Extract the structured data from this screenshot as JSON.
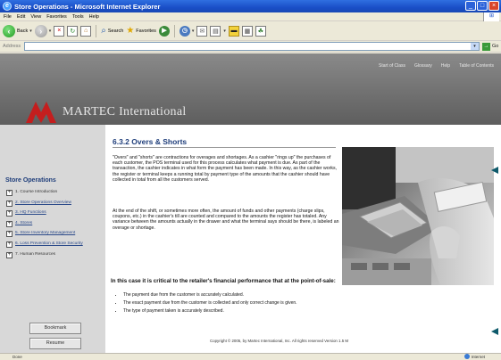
{
  "window": {
    "title": "Store Operations - Microsoft Internet Explorer"
  },
  "menu": [
    "File",
    "Edit",
    "View",
    "Favorites",
    "Tools",
    "Help"
  ],
  "toolbar": {
    "back": "Back",
    "search": "Search",
    "favorites": "Favorites"
  },
  "address": {
    "label": "Address",
    "value": "",
    "go_label": "Go"
  },
  "topnav": [
    "Start of Class",
    "Glossary",
    "Help",
    "Table of Contents"
  ],
  "brand": {
    "name": "MARTEC International"
  },
  "sidebar": {
    "title": "Store Operations",
    "items": [
      {
        "label": "1. Course Introduction"
      },
      {
        "label": "2. Store Operations Overview"
      },
      {
        "label": "3. HQ Functions"
      },
      {
        "label": "4. Stores"
      },
      {
        "label": "5. Store Inventory Management"
      },
      {
        "label": "6. Loss Prevention & Store Security"
      },
      {
        "label": "7. Human Resources"
      }
    ],
    "bookmark_label": "Bookmark",
    "resume_label": "Resume"
  },
  "main": {
    "title": "6.3.2 Overs & Shorts",
    "para1": "\"Overs\" and \"shorts\" are contractions for overages and shortages. As a cashier \"rings up\" the purchases of each customer, the POS terminal used for this process calculates what payment is due. As part of the transaction, the cashier indicates in what form the payment has been made. In this way, as the cashier works, the register or terminal keeps a running total by payment type of the amounts that the cashier should have collected in total from all the customers served.",
    "para2": "At the end of the shift, or sometimes more often, the amount of funds and other payments (charge slips, coupons, etc.) in the cashier's till are counted and compared to the amounts the register has totaled. Any variance between the amounts actually in the drawer and what the terminal says should be there, is labeled an overage or shortage.",
    "critical": "In this case it is critical to the retailer's financial performance that at the point-of-sale:",
    "bullets": [
      "The payment due from the customer is accurately calculated.",
      "The exact payment due from the customer is collected and only correct change is given.",
      "The type of payment taken is accurately described."
    ],
    "copyright": "Copyright © 2005, by Martec International, Inc. All rights reserved Version 1.5 M"
  },
  "status": {
    "text": "Done",
    "zone": "Internet"
  },
  "colors": {
    "title_blue": "#1e3d7a",
    "logo_red": "#c41e1e",
    "header_grey": "#6f6f6f",
    "sidebar_grey": "#d8d8d8",
    "arrow_teal": "#0e5a6b"
  }
}
